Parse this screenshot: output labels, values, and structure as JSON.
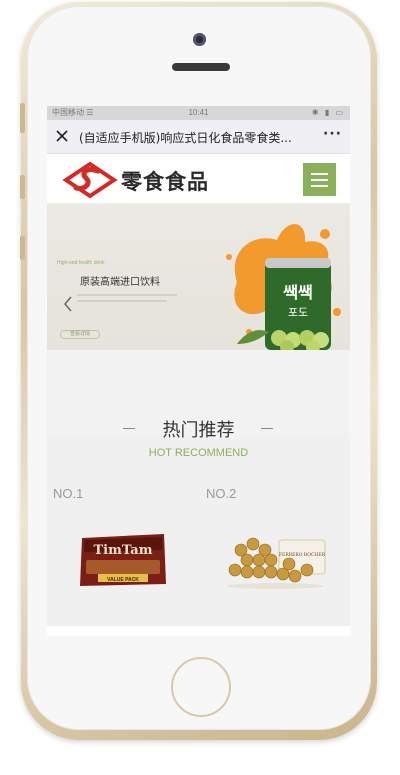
{
  "status_bar": {
    "carrier": "中国移动 ☰",
    "time": "10:41",
    "right": "✱ ▮ ▭"
  },
  "wechat_bar": {
    "close_icon": "close-icon",
    "title": "(自适应手机版)响应式日化食品零食类...",
    "more": "···"
  },
  "header": {
    "logo_text": "零食食品",
    "logo_icon": "brand-s-logo-icon",
    "menu_icon": "hamburger-menu-icon",
    "accent_color": "#8bb05a",
    "logo_color": "#d42a26"
  },
  "banner": {
    "kicker": "High-end health drink",
    "title": "原装高端进口饮料",
    "button_label": "查看详情",
    "arrow_icon": "chevron-left-icon",
    "can_text_top": "쌕쌕",
    "can_text_bottom": "포도"
  },
  "hot_section": {
    "title": "热门推荐",
    "subtitle": "HOT RECOMMEND",
    "products": [
      {
        "rank": "NO.1",
        "name": "TimTam",
        "pack_label": "VALUE PACK"
      },
      {
        "rank": "NO.2",
        "name": "FERRERO ROCHER",
        "pack_label": ""
      }
    ]
  }
}
